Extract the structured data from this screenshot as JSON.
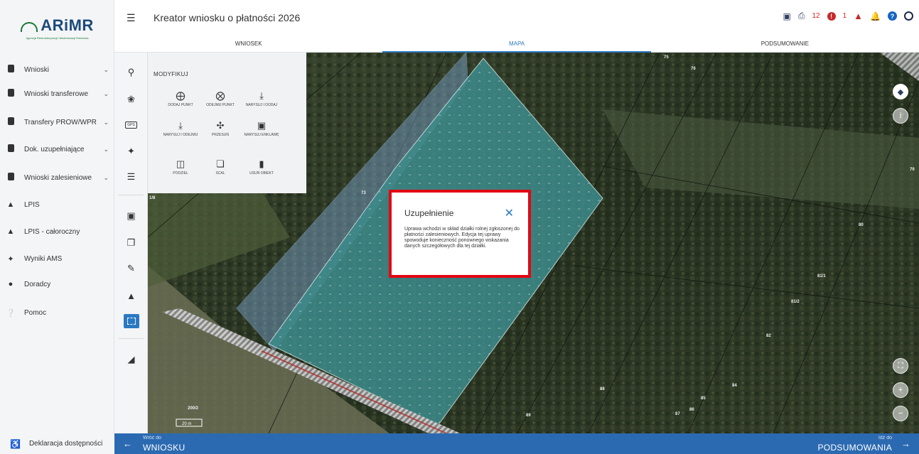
{
  "brand": {
    "name": "ARiMR",
    "tagline": "Agencja Restrukturyzacji i Modernizacji Rolnictwa"
  },
  "header": {
    "title": "Kreator wniosku o płatności 2026",
    "warning_count": "12",
    "alert_count": "1"
  },
  "tabs": [
    "WNIOSEK",
    "MAPA",
    "PODSUMOWANIE"
  ],
  "sidebar": {
    "items": [
      {
        "label": "Wnioski",
        "icon": "document-icon",
        "expandable": true
      },
      {
        "label": "Wnioski transferowe",
        "icon": "document-icon",
        "expandable": true
      },
      {
        "label": "Transfery PROW/WPR",
        "icon": "document-icon",
        "expandable": true
      },
      {
        "label": "Dok. uzupełniające",
        "icon": "document-icon",
        "expandable": true
      },
      {
        "label": "Wnioski zalesieniowe",
        "icon": "document-icon",
        "expandable": true
      },
      {
        "label": "LPIS",
        "icon": "mountain-icon",
        "expandable": false
      },
      {
        "label": "LPIS - całoroczny",
        "icon": "mountain-icon",
        "expandable": false
      },
      {
        "label": "Wyniki AMS",
        "icon": "satellite-icon",
        "expandable": false
      },
      {
        "label": "Doradcy",
        "icon": "user-icon",
        "expandable": false
      },
      {
        "label": "Pomoc",
        "icon": "help-icon",
        "expandable": false
      }
    ],
    "accessibility": "Deklaracja dostępności"
  },
  "modify_panel": {
    "title": "MODYFIKUJ",
    "buttons": [
      {
        "label": "DODAJ PUNKT",
        "icon": "add-point-icon"
      },
      {
        "label": "ODEJMIJ PUNKT",
        "icon": "remove-point-icon"
      },
      {
        "label": "NARYSUJ I DODAJ",
        "icon": "draw-add-icon"
      },
      {
        "label": "NARYSUJ I ODEJMIJ",
        "icon": "draw-subtract-icon"
      },
      {
        "label": "PRZESUŃ",
        "icon": "move-icon"
      },
      {
        "label": "NARYSUJ ENKLAWĘ",
        "icon": "enclave-icon"
      },
      {
        "label": "PODZIEL",
        "icon": "split-icon"
      },
      {
        "label": "SCAL",
        "icon": "merge-icon"
      },
      {
        "label": "USUŃ OBIEKT",
        "icon": "delete-icon"
      }
    ]
  },
  "dialog": {
    "title": "Uzupełnienie",
    "body": "Uprawa wchodzi w skład działki rolnej zgłoszonej do płatności zalesieniowych. Edycja tej uprawy spowoduje konieczność ponownego wskazania danych szczegółowych dla tej działki."
  },
  "map": {
    "plot_labels": [
      "75",
      "76",
      "79",
      "80",
      "81/1",
      "81/2",
      "82",
      "84",
      "85",
      "86",
      "87",
      "88",
      "89",
      "73",
      "200/2",
      "1/8"
    ],
    "scale": "20 m"
  },
  "footer": {
    "back_small": "Wróć do",
    "back_big": "WNIOSKU",
    "next_small": "Idź do",
    "next_big": "PODSUMOWANIA"
  },
  "colors": {
    "accent": "#2b79c2",
    "footer": "#2b6ab1",
    "dialog_border": "#e30613",
    "parcel_fill": "#3d8c8c"
  }
}
